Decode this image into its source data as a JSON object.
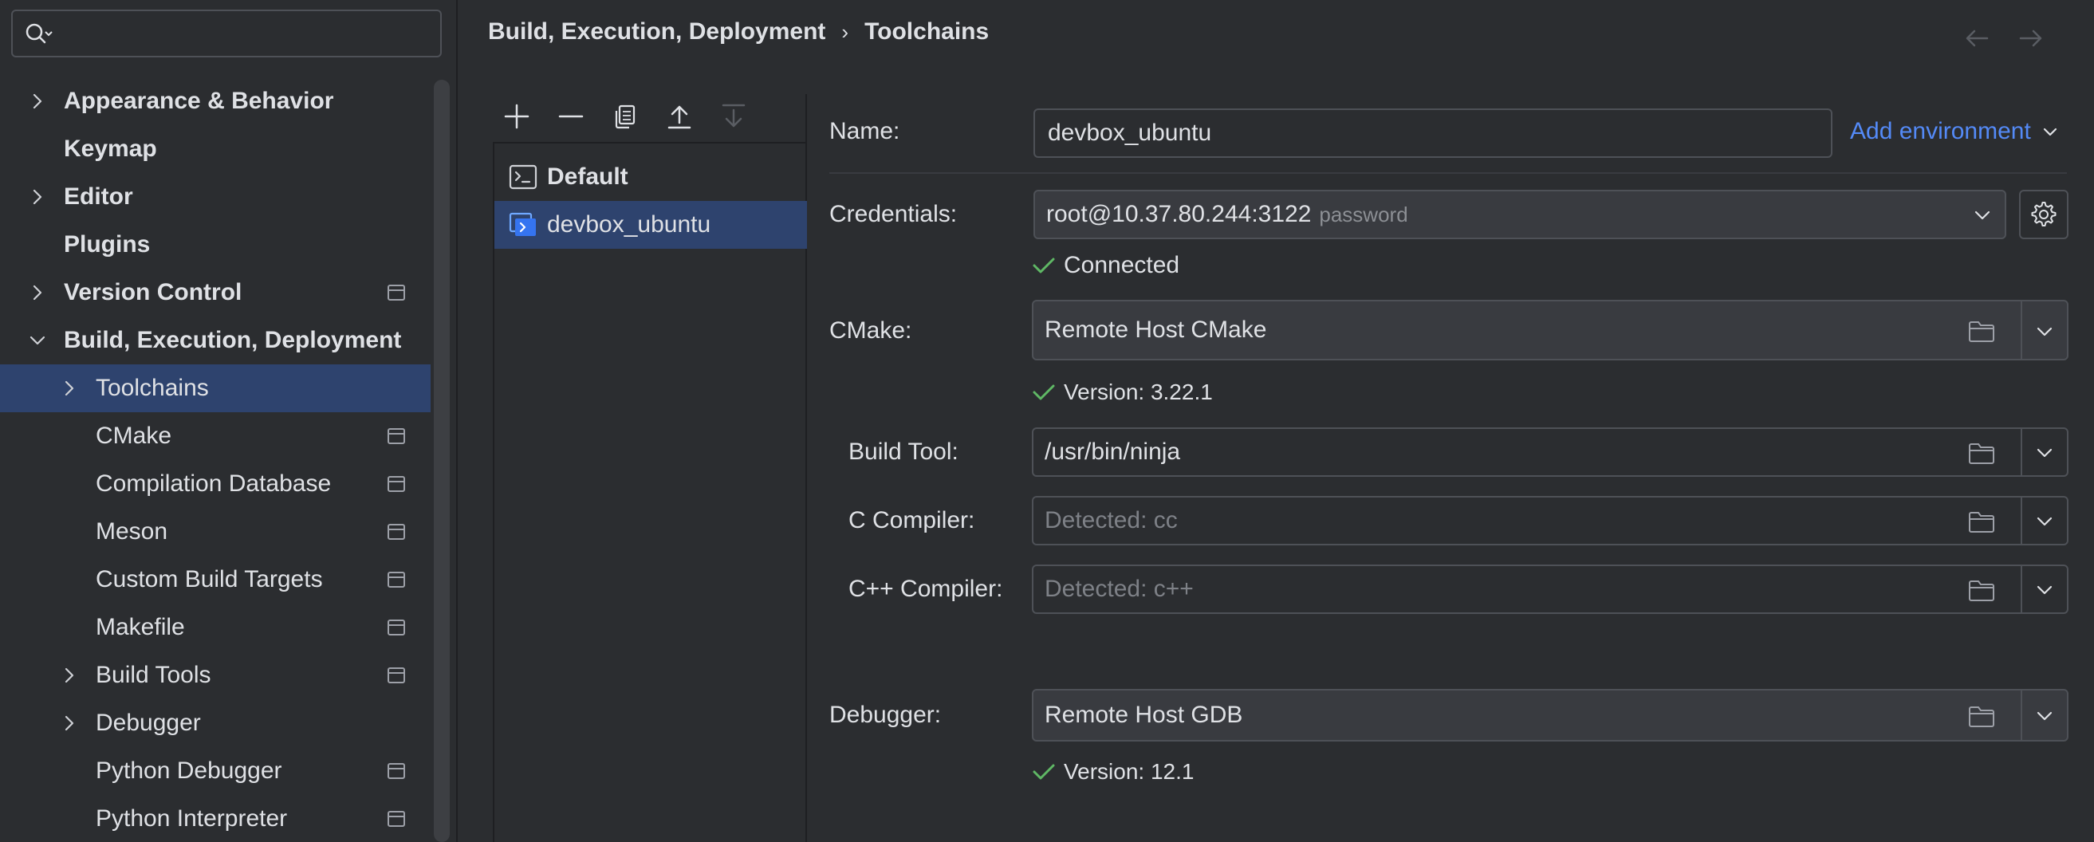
{
  "search": {
    "value": "",
    "placeholder": ""
  },
  "sidebar": {
    "items": [
      {
        "label": "Appearance & Behavior",
        "level": 0,
        "expandable": true,
        "expanded": false,
        "project_icon": false,
        "selected": false
      },
      {
        "label": "Keymap",
        "level": 0,
        "expandable": false,
        "project_icon": false,
        "selected": false
      },
      {
        "label": "Editor",
        "level": 0,
        "expandable": true,
        "expanded": false,
        "project_icon": false,
        "selected": false
      },
      {
        "label": "Plugins",
        "level": 0,
        "expandable": false,
        "project_icon": false,
        "selected": false
      },
      {
        "label": "Version Control",
        "level": 0,
        "expandable": true,
        "expanded": false,
        "project_icon": true,
        "selected": false
      },
      {
        "label": "Build, Execution, Deployment",
        "level": 0,
        "expandable": true,
        "expanded": true,
        "project_icon": false,
        "selected": false
      },
      {
        "label": "Toolchains",
        "level": 1,
        "expandable": true,
        "expanded": false,
        "project_icon": false,
        "selected": true
      },
      {
        "label": "CMake",
        "level": 1,
        "expandable": false,
        "project_icon": true,
        "selected": false
      },
      {
        "label": "Compilation Database",
        "level": 1,
        "expandable": false,
        "project_icon": true,
        "selected": false
      },
      {
        "label": "Meson",
        "level": 1,
        "expandable": false,
        "project_icon": true,
        "selected": false
      },
      {
        "label": "Custom Build Targets",
        "level": 1,
        "expandable": false,
        "project_icon": true,
        "selected": false
      },
      {
        "label": "Makefile",
        "level": 1,
        "expandable": false,
        "project_icon": true,
        "selected": false
      },
      {
        "label": "Build Tools",
        "level": 1,
        "expandable": true,
        "expanded": false,
        "project_icon": true,
        "selected": false
      },
      {
        "label": "Debugger",
        "level": 1,
        "expandable": true,
        "expanded": false,
        "project_icon": false,
        "selected": false
      },
      {
        "label": "Python Debugger",
        "level": 1,
        "expandable": false,
        "project_icon": true,
        "selected": false
      },
      {
        "label": "Python Interpreter",
        "level": 1,
        "expandable": false,
        "project_icon": true,
        "selected": false
      }
    ]
  },
  "header": {
    "breadcrumb": [
      "Build, Execution, Deployment",
      "Toolchains"
    ],
    "separator": "›"
  },
  "toolchains": {
    "toolbar": [
      "add-icon",
      "remove-icon",
      "copy-icon",
      "move-up-icon",
      "move-down-icon"
    ],
    "items": [
      {
        "label": "Default",
        "selected": false
      },
      {
        "label": "devbox_ubuntu",
        "selected": true
      }
    ]
  },
  "form": {
    "name_label": "Name:",
    "name_value": "devbox_ubuntu",
    "add_environment": "Add environment",
    "credentials_label": "Credentials:",
    "credentials_value": "root@10.37.80.244:3122",
    "credentials_hint": "password",
    "connected_status": "Connected",
    "cmake_label": "CMake:",
    "cmake_value": "Remote Host CMake",
    "cmake_version": "Version: 3.22.1",
    "build_tool_label": "Build Tool:",
    "build_tool_value": "/usr/bin/ninja",
    "c_compiler_label": "C Compiler:",
    "c_compiler_placeholder": "Detected: cc",
    "cxx_compiler_label": "C++ Compiler:",
    "cxx_compiler_placeholder": "Detected: c++",
    "debugger_label": "Debugger:",
    "debugger_value": "Remote Host GDB",
    "debugger_version": "Version: 12.1"
  },
  "colors": {
    "background": "#2b2d30",
    "selection": "#2e436e",
    "link": "#548af7",
    "success": "#5fb865",
    "border": "#4e5157"
  }
}
